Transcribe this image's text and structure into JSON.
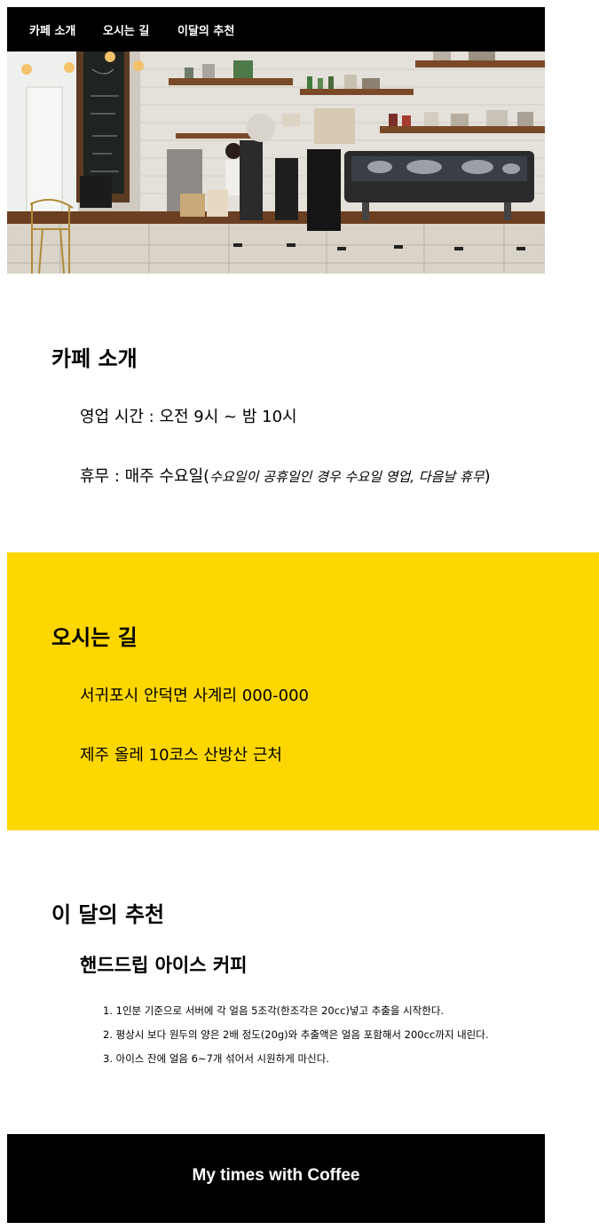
{
  "nav": {
    "items": [
      {
        "label": "카페 소개"
      },
      {
        "label": "오시는 길"
      },
      {
        "label": "이달의 추천"
      }
    ]
  },
  "intro": {
    "title": "카페 소개",
    "hours": "영업 시간 : 오전 9시 ~ 밤 10시",
    "closed_prefix": "휴무 : 매주 수요일(",
    "closed_note": "수요일이 공휴일인 경우 수요일 영업, 다음날 휴무",
    "closed_suffix": ")"
  },
  "directions": {
    "title": "오시는 길",
    "address": "서귀포시 안덕면 사계리 000-000",
    "landmark": "제주 올레 10코스 산방산 근처"
  },
  "recommend": {
    "title": "이 달의 추천",
    "item_title": "핸드드립 아이스 커피",
    "steps": [
      "1. 1인분 기준으로 서버에 각 얼음 5조각(한조각은 20cc)넣고 추출을 시작한다.",
      "2. 평상시 보다 원두의 양은 2배 정도(20g)와 추출액은 얼음 포함해서 200cc까지 내린다.",
      "3. 아이스 잔에 얼음 6~7개 섞어서 시원하게 마신다."
    ]
  },
  "footer": {
    "text": "My times with Coffee"
  },
  "colors": {
    "nav_bg": "#000000",
    "highlight_bg": "#FFD700",
    "footer_bg": "#000000"
  },
  "images": {
    "hero": "cafe-interior-photo"
  }
}
